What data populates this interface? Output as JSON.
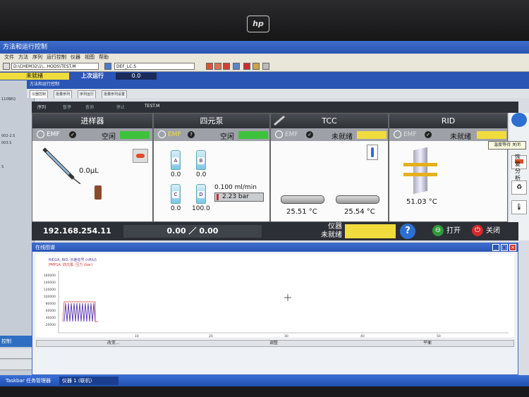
{
  "monitor": {
    "brand": "hp"
  },
  "app": {
    "title": "方法和运行控制"
  },
  "toolbar": {
    "method_path": "D:\\CHEM32\\1\\...HODS\\TEST.M",
    "sequence_file": "DEF_LC.S"
  },
  "status_row": {
    "status": "未就绪",
    "last_run_label": "上次运行",
    "last_run_value": "0.0"
  },
  "left_pane": {
    "labels": [
      "110BEQ",
      "002-2.S",
      "003.S",
      "S"
    ],
    "active_tab": "控制"
  },
  "subwindow": {
    "title": "方法和运行控制"
  },
  "tabs": [
    "仪器控制",
    "批量序列",
    "序列运行",
    "批量序列设置"
  ],
  "seqbar": {
    "items": [
      "序列",
      "暂停",
      "查询",
      "停止",
      "TEST.M"
    ]
  },
  "modules": {
    "sampler": {
      "title": "进样器",
      "emf": "EMF",
      "state": "空闲",
      "state_color": "#3ec23e",
      "injection": "0.0µL"
    },
    "pump": {
      "title": "四元泵",
      "emf": "EMF",
      "state": "空闲",
      "state_color": "#3ec23e",
      "bottles": [
        {
          "id": "A",
          "value": "0.0"
        },
        {
          "id": "B",
          "value": "0.0"
        },
        {
          "id": "C",
          "value": "0.0"
        },
        {
          "id": "D",
          "value": "100.0"
        }
      ],
      "flow": "0.100 ml/min",
      "pressure": "2.23 bar"
    },
    "tcc": {
      "title": "TCC",
      "emf": "EMF",
      "state": "未就绪",
      "state_color": "#f0dc3c",
      "left_temp": "25.51 °C",
      "right_temp": "25.54 °C"
    },
    "rid": {
      "title": "RID",
      "emf": "EMF",
      "state": "未就绪",
      "state_color": "#f0dc3c",
      "temp": "51.03 °C",
      "tooltip": "温度等待 关闭"
    }
  },
  "statusbar": {
    "ip": "192.168.254.11",
    "pressure_readout": "0.00 ／ 0.00",
    "instrument_label_1": "仪器",
    "instrument_label_2": "未就绪",
    "instrument_color": "#f0dc3c",
    "help": "?",
    "open_label": "打开",
    "close_label": "关闭"
  },
  "side_panel": {
    "label": "恢复分析"
  },
  "online_plot": {
    "title": "在线图谱",
    "legend": [
      "RID1A, RID, 示差信号 (nRIU)",
      "PMP1A, 四元泵, 压力 (bar)"
    ],
    "yticks": [
      "160000",
      "140000",
      "120000",
      "100000",
      "80000",
      "60000",
      "40000",
      "20000"
    ],
    "xticks": [
      "10",
      "20",
      "30",
      "40",
      "50"
    ],
    "footer": [
      "改变...",
      "调整",
      "平衡"
    ]
  },
  "taskbar": {
    "items": [
      "Taskbar 任务管理器",
      "仪器 1 (联机)"
    ]
  }
}
